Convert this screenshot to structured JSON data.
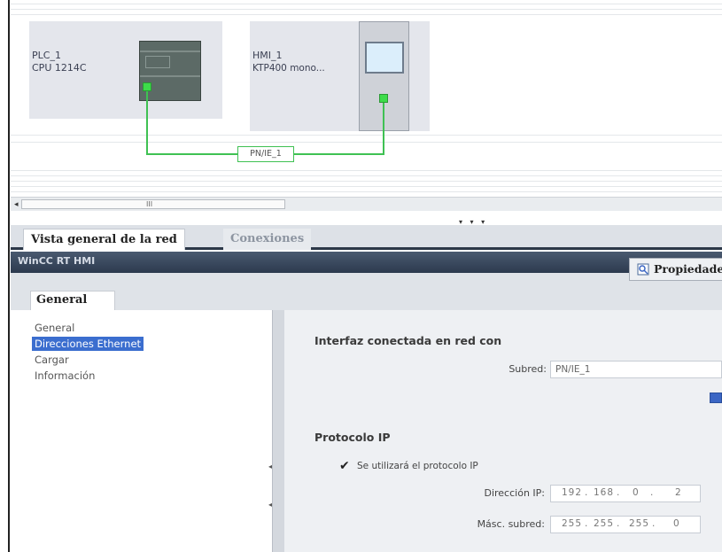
{
  "network": {
    "plc": {
      "name": "PLC_1",
      "model": "CPU 1214C"
    },
    "hmi": {
      "name": "HMI_1",
      "model": "KTP400 mono..."
    },
    "subnet_label": "PN/IE_1"
  },
  "scrollbar": {
    "left_arrow": "◂",
    "grip": "III"
  },
  "tabs": {
    "network_overview": "Vista general de la red",
    "connections": "Conexiones"
  },
  "inspector": {
    "title": "WinCC RT HMI",
    "properties_tab": "Propiedades",
    "general_tab": "General"
  },
  "nav": {
    "items": [
      "General",
      "Direcciones Ethernet",
      "Cargar",
      "Información"
    ],
    "selected_index": 1
  },
  "content": {
    "interface_section": "Interfaz conectada en red con",
    "subnet_label": "Subred:",
    "subnet_value": "PN/IE_1",
    "ip_section": "Protocolo IP",
    "use_ip_label": "Se utilizará el protocolo IP",
    "use_ip_checked": true,
    "ip_address_label": "Dirección IP:",
    "ip_address": [
      "192",
      "168",
      "0",
      "2"
    ],
    "subnet_mask_label": "Másc. subred:",
    "subnet_mask": [
      "255",
      "255",
      "255",
      "0"
    ]
  },
  "colors": {
    "network_wire": "#3fc153",
    "selection": "#3b6ecf",
    "header_dark": "#2c3a4e"
  }
}
